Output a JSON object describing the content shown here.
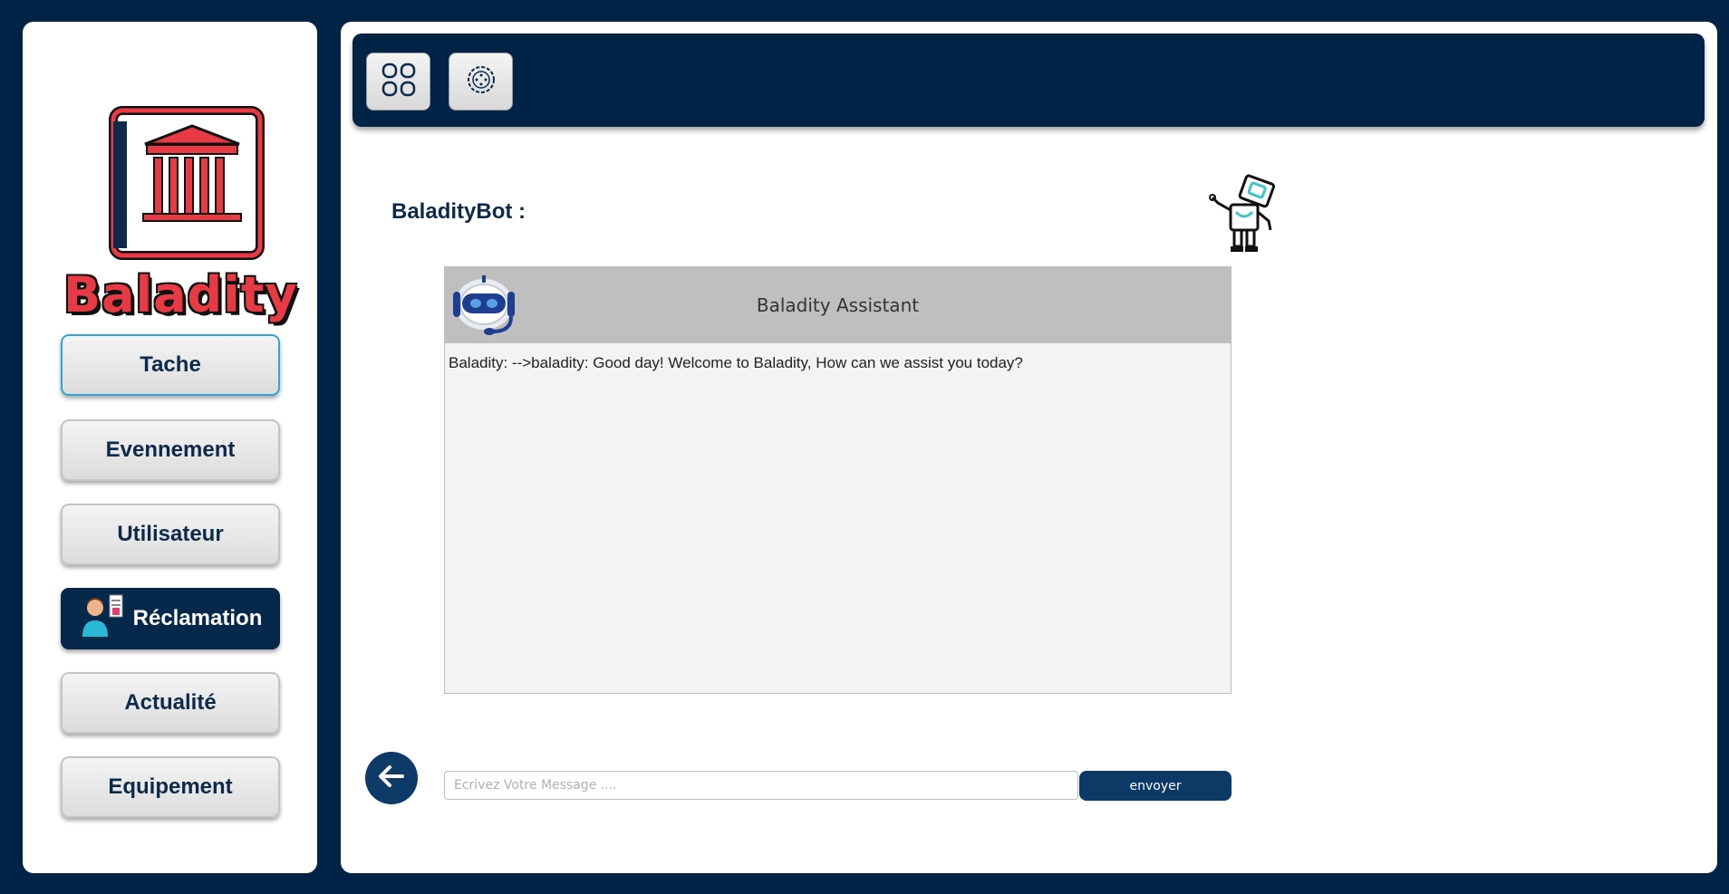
{
  "sidebar": {
    "logo_text": "Baladity",
    "items": [
      {
        "label": "Tache"
      },
      {
        "label": "Evennement"
      },
      {
        "label": "Utilisateur"
      },
      {
        "label": "Réclamation"
      },
      {
        "label": "Actualité"
      },
      {
        "label": "Equipement"
      }
    ]
  },
  "topbar": {
    "icons": [
      "dashboard-grid-icon",
      "settings-gear-icon"
    ]
  },
  "main": {
    "bot_label": "BaladityBot :",
    "chat": {
      "title": "Baladity Assistant",
      "messages": [
        {
          "text": "Baladity: -->baladity: Good day! Welcome to Baladity, How can we assist you today?"
        }
      ]
    },
    "input": {
      "placeholder": "Ecrivez Votre Message ....",
      "value": ""
    },
    "send_label": "envoyer"
  },
  "colors": {
    "background": "#012345",
    "accent": "#0b3a66",
    "logo_red": "#e83a45",
    "focus_border": "#2fa6d9"
  }
}
